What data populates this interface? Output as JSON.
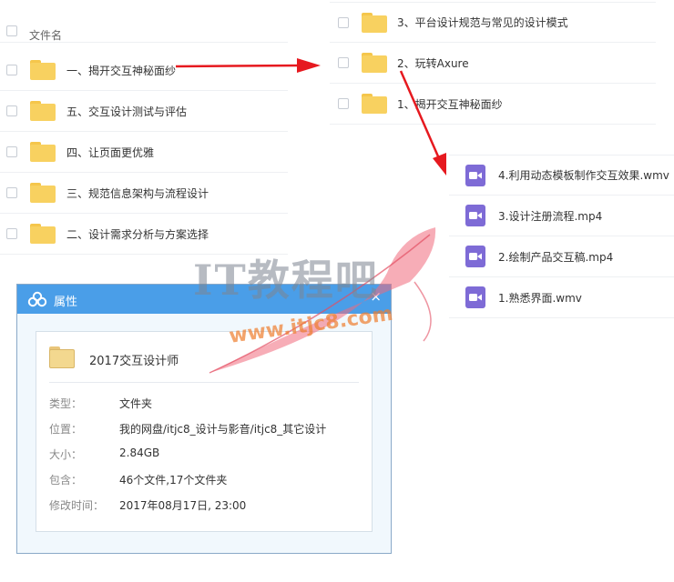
{
  "left_list": {
    "partial_header": "文件名",
    "items": [
      {
        "label": "一、揭开交互神秘面纱"
      },
      {
        "label": "五、交互设计测试与评估"
      },
      {
        "label": "四、让页面更优雅"
      },
      {
        "label": "三、规范信息架构与流程设计"
      },
      {
        "label": "二、设计需求分析与方案选择"
      }
    ]
  },
  "right_folders": {
    "items": [
      {
        "label": "3、平台设计规范与常见的设计模式"
      },
      {
        "label": "2、玩转Axure"
      },
      {
        "label": "1、揭开交互神秘面纱"
      }
    ]
  },
  "right_files": {
    "items": [
      {
        "label": "4.利用动态模板制作交互效果.wmv"
      },
      {
        "label": "3.设计注册流程.mp4"
      },
      {
        "label": "2.绘制产品交互稿.mp4"
      },
      {
        "label": "1.熟悉界面.wmv"
      }
    ]
  },
  "dialog": {
    "title": "属性",
    "close": "×",
    "folder_name": "2017交互设计师",
    "rows": [
      {
        "key": "类型：",
        "value": "文件夹"
      },
      {
        "key": "位置：",
        "value": "我的网盘/itjc8_设计与影音/itjc8_其它设计"
      },
      {
        "key": "大小：",
        "value": "2.84GB"
      },
      {
        "key": "包含：",
        "value": "46个文件,17个文件夹"
      },
      {
        "key": "修改时间：",
        "value": "2017年08月17日, 23:00"
      }
    ]
  },
  "watermark": {
    "text": "IT教程吧",
    "url": "www.itjc8.com"
  },
  "colors": {
    "accent": "#4a9ee8",
    "folder": "#f8d160",
    "video": "#7e6bd6",
    "arrow": "#e6191f"
  }
}
